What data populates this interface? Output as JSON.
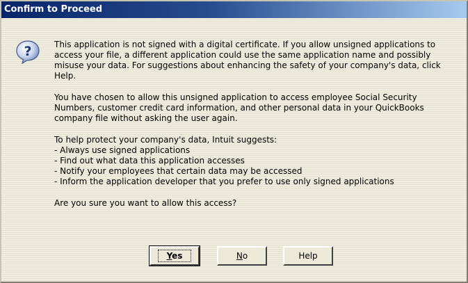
{
  "dialog": {
    "title": "Confirm to Proceed",
    "icon": "question-icon",
    "paragraphs": [
      "This application is not signed with a digital certificate.  If you allow unsigned applications to access your file, a different application could use the same application name and possibly misuse your data.  For suggestions about enhancing the safety of your company's data, click Help.",
      "You have chosen to allow this unsigned application to access employee Social Security Numbers, customer credit card information, and other personal data in your QuickBooks company file without asking the user again.",
      "To help protect your company's data, Intuit suggests:"
    ],
    "suggestions": [
      "- Always use signed applications",
      "- Find out what data this application accesses",
      "- Notify your employees that certain data may be accessed",
      "- Inform the application developer that you prefer to use only signed applications"
    ],
    "question": "Are you sure you want to allow this access?"
  },
  "buttons": {
    "yes_label": "Yes",
    "no_label": "No",
    "help_label": "Help"
  },
  "colors": {
    "titlebar_start": "#0a246a",
    "titlebar_end": "#a6caf0",
    "dialog_background": "#ece9d8"
  }
}
